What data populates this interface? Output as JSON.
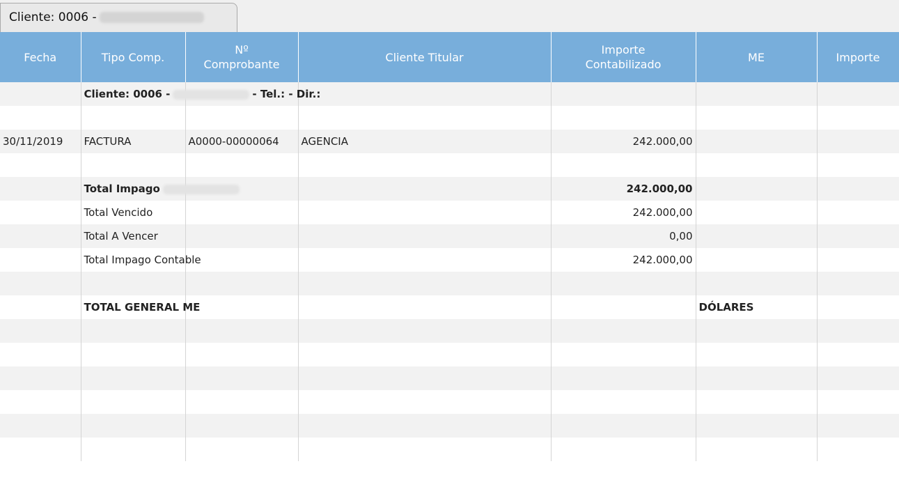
{
  "tab": {
    "label": "Cliente: 0006 -"
  },
  "columns": [
    "Fecha",
    "Tipo Comp.",
    "Nº Comprobante",
    "Cliente Titular",
    "Importe Contabilizado",
    "ME",
    "Importe"
  ],
  "header": {
    "fecha": "Fecha",
    "tipo": "Tipo Comp.",
    "nro_line1": "Nº",
    "nro_line2": "Comprobante",
    "titular": "Cliente Titular",
    "importe_line1": "Importe",
    "importe_line2": "Contabilizado",
    "me": "ME",
    "importe2": "Importe"
  },
  "client_row": {
    "prefix": "Cliente: 0006 -",
    "suffix": "- Tel.: - Dir.:"
  },
  "invoice_row": {
    "fecha": "30/11/2019",
    "tipo": "FACTURA",
    "nro": "A0000-00000064",
    "titular": "AGENCIA",
    "importe": "242.000,00"
  },
  "totals": {
    "impago_label": "Total Impago",
    "impago_value": "242.000,00",
    "vencido_label": "Total Vencido",
    "vencido_value": "242.000,00",
    "a_vencer_label": "Total A Vencer",
    "a_vencer_value": "0,00",
    "contable_label": "Total Impago Contable",
    "contable_value": "242.000,00",
    "general_label": "TOTAL GENERAL ME",
    "general_currency": "DÓLARES"
  },
  "colors": {
    "header_bg": "#78aedb",
    "stripe": "#f2f2f2"
  }
}
